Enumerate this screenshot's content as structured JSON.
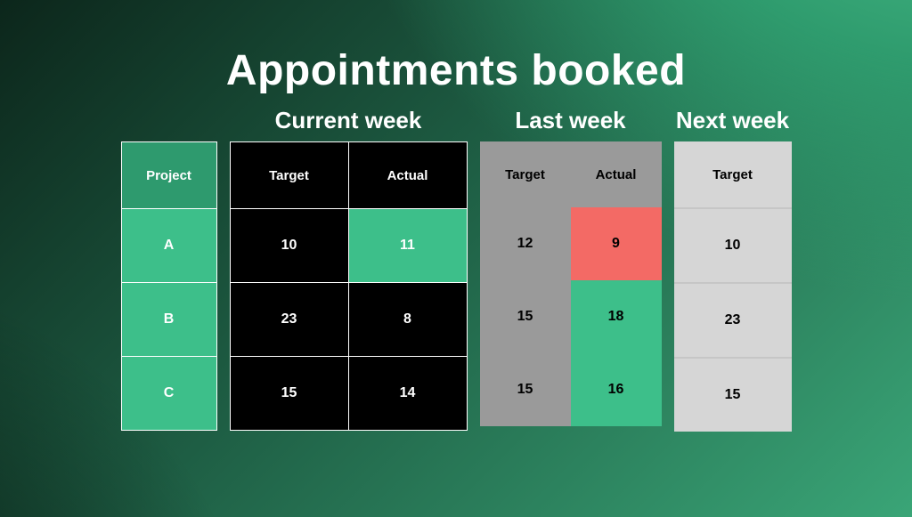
{
  "title": "Appointments booked",
  "headers": {
    "project": "Project",
    "current": "Current week",
    "last": "Last week",
    "next": "Next week",
    "target": "Target",
    "actual": "Actual"
  },
  "projects": [
    "A",
    "B",
    "C"
  ],
  "current": {
    "target": [
      10,
      23,
      15
    ],
    "actual": [
      11,
      8,
      14
    ],
    "actual_state": [
      "green",
      "none",
      "none"
    ]
  },
  "last": {
    "target": [
      12,
      15,
      15
    ],
    "actual": [
      9,
      18,
      16
    ],
    "actual_state": [
      "red",
      "green",
      "green"
    ]
  },
  "next": {
    "target": [
      10,
      23,
      15
    ]
  },
  "chart_data": {
    "type": "table",
    "title": "Appointments booked",
    "columns": [
      "Project",
      "Current week Target",
      "Current week Actual",
      "Last week Target",
      "Last week Actual",
      "Next week Target"
    ],
    "rows": [
      [
        "A",
        10,
        11,
        12,
        9,
        10
      ],
      [
        "B",
        23,
        8,
        15,
        18,
        23
      ],
      [
        "C",
        15,
        14,
        15,
        16,
        15
      ]
    ],
    "highlights": {
      "current_actual": {
        "A": "good"
      },
      "last_actual": {
        "A": "bad",
        "B": "good",
        "C": "good"
      }
    }
  }
}
